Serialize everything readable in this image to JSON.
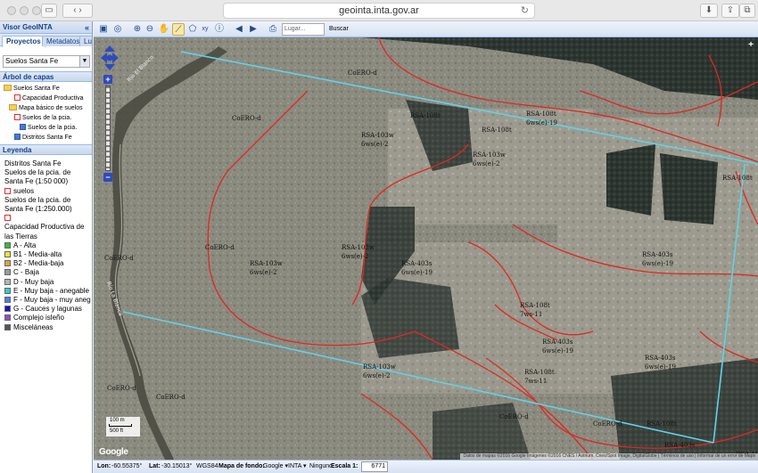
{
  "browser": {
    "url": "geointa.inta.gov.ar",
    "reload_icon": "reload-icon"
  },
  "panel": {
    "title": "Visor GeoINTA",
    "collapse_glyph": "«",
    "tabs": [
      {
        "label": "Proyectos",
        "active": true
      },
      {
        "label": "Metadatos",
        "active": false
      },
      {
        "label": "Lu",
        "active": false
      }
    ],
    "project_select": "Suelos Santa Fe",
    "tree_title": "Árbol de capas",
    "tree": [
      {
        "label": "Suelos Santa Fe",
        "indent": 0,
        "kind": "folder"
      },
      {
        "label": "Capacidad Productiva",
        "indent": 2,
        "kind": "checkbox",
        "checked": false
      },
      {
        "label": "Mapa básico de suelos",
        "indent": 1,
        "kind": "folder"
      },
      {
        "label": "Suelos de la pcia.",
        "indent": 2,
        "kind": "checkbox",
        "checked": false
      },
      {
        "label": "Suelos de la pcia.",
        "indent": 3,
        "kind": "checkbox",
        "checked": true
      },
      {
        "label": "Distritos Santa Fe",
        "indent": 2,
        "kind": "checkbox",
        "checked": true
      }
    ],
    "legend_title": "Leyenda",
    "legend": [
      {
        "text": "Distritos Santa Fe",
        "swatch": null
      },
      {
        "text": "Suelos de la pcia. de",
        "swatch": null
      },
      {
        "text": "Santa Fe (1:50 000)",
        "swatch": null
      },
      {
        "text": "suelos",
        "swatch": "#ffffff",
        "border": "#d33"
      },
      {
        "text": "Suelos de la pcia. de",
        "swatch": null
      },
      {
        "text": "Santa Fe (1:250.000)",
        "swatch": null
      },
      {
        "text": "",
        "swatch": "#ffffff",
        "border": "#d33"
      },
      {
        "text": "Capacidad Productiva de",
        "swatch": null
      },
      {
        "text": "las Tierras",
        "swatch": null
      },
      {
        "text": "A - Alta",
        "swatch": "#2fbf2f"
      },
      {
        "text": "B1 - Media-alta",
        "swatch": "#e6e62e"
      },
      {
        "text": "B2 - Media-baja",
        "swatch": "#e0a53a"
      },
      {
        "text": "C - Baja",
        "swatch": "#9a9a9a"
      },
      {
        "text": "D - Muy baja",
        "swatch": "#b5b5b5"
      },
      {
        "text": "E - Muy baja - anegable",
        "swatch": "#33cccc"
      },
      {
        "text": "F - Muy baja - muy aneg",
        "swatch": "#4a7ef0"
      },
      {
        "text": "G - Cauces y lagunas",
        "swatch": "#1010d0"
      },
      {
        "text": "Complejo isleño",
        "swatch": "#8e4fc4"
      },
      {
        "text": "Misceláneas",
        "swatch": "#555555"
      }
    ]
  },
  "toolbar": {
    "tools": [
      {
        "name": "new-map-icon",
        "glyph": "▣"
      },
      {
        "name": "full-extent-icon",
        "glyph": "◎"
      },
      {
        "name": "zoom-in-icon",
        "glyph": "⊕"
      },
      {
        "name": "zoom-out-icon",
        "glyph": "⊖"
      },
      {
        "name": "pan-hand-icon",
        "glyph": "✋"
      },
      {
        "name": "measure-distance-icon",
        "glyph": "⟋",
        "active": true
      },
      {
        "name": "measure-area-icon",
        "glyph": "⬠"
      },
      {
        "name": "coordinates-icon",
        "glyph": "xy"
      },
      {
        "name": "info-icon",
        "glyph": "ⓘ"
      },
      {
        "name": "previous-view-icon",
        "glyph": "◀"
      },
      {
        "name": "next-view-icon",
        "glyph": "▶"
      },
      {
        "name": "print-icon",
        "glyph": "⎙"
      }
    ],
    "search_placeholder": "Lugar...",
    "search_button": "Buscar"
  },
  "map": {
    "scale_top": "100 m",
    "scale_bottom": "500 ft",
    "google_logo": "Google",
    "attribution": "Datos de mapas ©2016 Google Imágenes ©2016 CNES / Astrium, Cnes/Spot Image, DigitalGlobe | Términos de uso | Informar de un error de Maps",
    "labels": [
      {
        "text": "Río El Blanco"
      },
      {
        "text": "CoERO-d"
      },
      {
        "text": "CoERO-d"
      },
      {
        "text": "RSA-108t"
      },
      {
        "text": "RSA-103w"
      },
      {
        "text": "6ws(e)-2"
      },
      {
        "text": "RSA-103w"
      },
      {
        "text": "6ws(e)-2"
      },
      {
        "text": "RSA-108t"
      },
      {
        "text": "6ws(e)-19"
      },
      {
        "text": "RSA-108t"
      },
      {
        "text": "RSA-108t"
      },
      {
        "text": "CoERO-d"
      },
      {
        "text": "RSA-103w"
      },
      {
        "text": "6ws(e)-2"
      },
      {
        "text": "RSA-103w"
      },
      {
        "text": "6ws(e)-2"
      },
      {
        "text": "RSA-403s"
      },
      {
        "text": "6ws(e)-19"
      },
      {
        "text": "RSA-403s"
      },
      {
        "text": "6ws(e)-19"
      },
      {
        "text": "CoERO-d"
      },
      {
        "text": "Río La Blanca"
      },
      {
        "text": "RSA-108t"
      },
      {
        "text": "7ws-11"
      },
      {
        "text": "RSA-403s"
      },
      {
        "text": "6ws(e)-19"
      },
      {
        "text": "RSA-403s"
      },
      {
        "text": "6ws(e)-19"
      },
      {
        "text": "RSA-103w"
      },
      {
        "text": "6ws(e)-2"
      },
      {
        "text": "RSA-108t"
      },
      {
        "text": "7ws-11"
      },
      {
        "text": "CoERO-d"
      },
      {
        "text": "CoERO-d"
      },
      {
        "text": "CoERO-d"
      },
      {
        "text": "CoERO-d"
      },
      {
        "text": "RSA-108t"
      },
      {
        "text": "RSA-403s"
      },
      {
        "text": "RSA-108t"
      }
    ]
  },
  "status": {
    "lon_label": "Lon:",
    "lon_value": "-60.55375°",
    "lat_label": "Lat:",
    "lat_value": "-30.15013°",
    "datum": "WGS84",
    "basemap_label": "Mapa de fondo:",
    "basemap_google": "Google ▾",
    "basemap_inta": "INTA ▾",
    "basemap_none": "Ninguno",
    "scale_label": "Escala 1:",
    "scale_value": "6771"
  }
}
